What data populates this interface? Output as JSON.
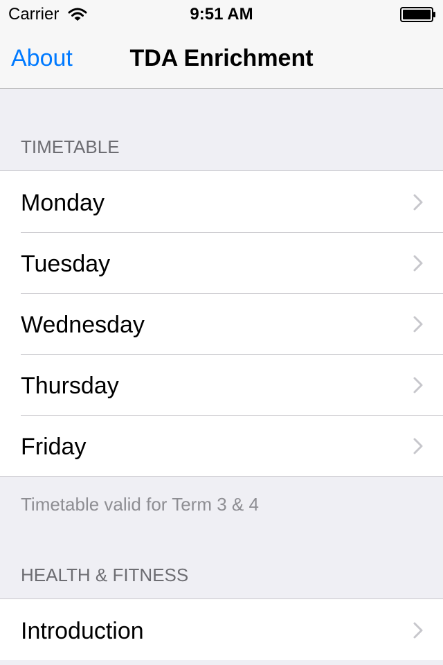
{
  "status_bar": {
    "carrier": "Carrier",
    "time": "9:51 AM",
    "wifi_icon": "wifi-icon",
    "battery_icon": "battery-icon"
  },
  "nav_bar": {
    "back_label": "About",
    "title": "TDA Enrichment"
  },
  "sections": [
    {
      "header": "TIMETABLE",
      "items": [
        {
          "label": "Monday"
        },
        {
          "label": "Tuesday"
        },
        {
          "label": "Wednesday"
        },
        {
          "label": "Thursday"
        },
        {
          "label": "Friday"
        }
      ],
      "footer": "Timetable valid for Term 3 & 4"
    },
    {
      "header": "HEALTH & FITNESS",
      "items": [
        {
          "label": "Introduction"
        }
      ]
    }
  ],
  "colors": {
    "accent": "#007aff",
    "background": "#efeff4",
    "separator": "#c8c7cc",
    "header_text": "#6d6d72",
    "footer_text": "#8e8e93",
    "chevron": "#c7c7cc"
  }
}
